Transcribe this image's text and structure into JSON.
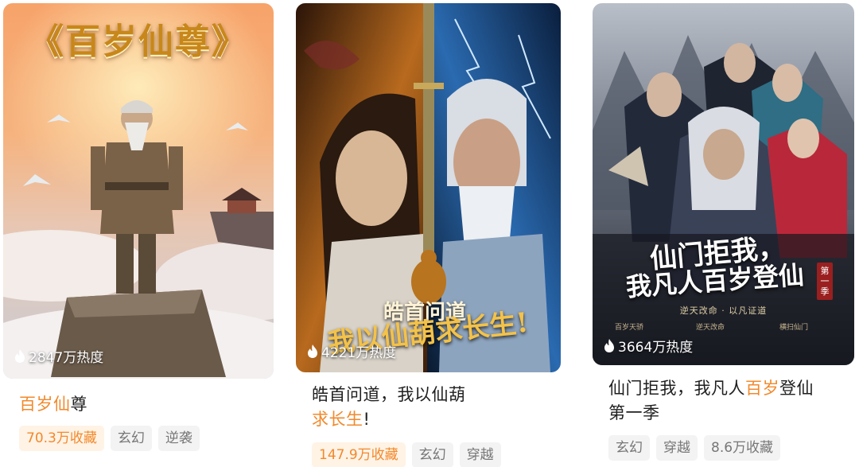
{
  "cards": [
    {
      "cover_title": "《百岁仙尊》",
      "heat": "2847万热度",
      "title_parts": [
        "百岁",
        "仙",
        "尊"
      ],
      "tags": [
        "70.3万收藏",
        "玄幻",
        "逆袭"
      ]
    },
    {
      "cover_text_top": "皓首问道",
      "cover_text_bottom": "我以仙葫求长生!",
      "heat": "4221万热度",
      "title_line1": "皓首问道，我以仙葫",
      "title_line2_hl": "求长生",
      "title_line2_rest": "!",
      "tags": [
        "147.9万收藏",
        "玄幻",
        "穿越"
      ]
    },
    {
      "cover_text_top": "仙门拒我，",
      "cover_text_bottom": "我凡人百岁登仙",
      "cover_badge": "第一季",
      "cover_subtitle": "逆天改命 · 以凡证道",
      "heat": "3664万热度",
      "title_line1_a": "仙门拒我，我凡人",
      "title_line1_hl": "百岁",
      "title_line1_b": "登仙",
      "title_line2": "第一季",
      "tags": [
        "玄幻",
        "穿越",
        "8.6万收藏"
      ]
    }
  ],
  "colors": {
    "highlight": "#f2892b",
    "tag_bg": "#f3f3f3",
    "tag_text": "#777777",
    "fav_tag_bg": "#fff3e6"
  },
  "icons": {
    "heat": "flame-icon"
  }
}
